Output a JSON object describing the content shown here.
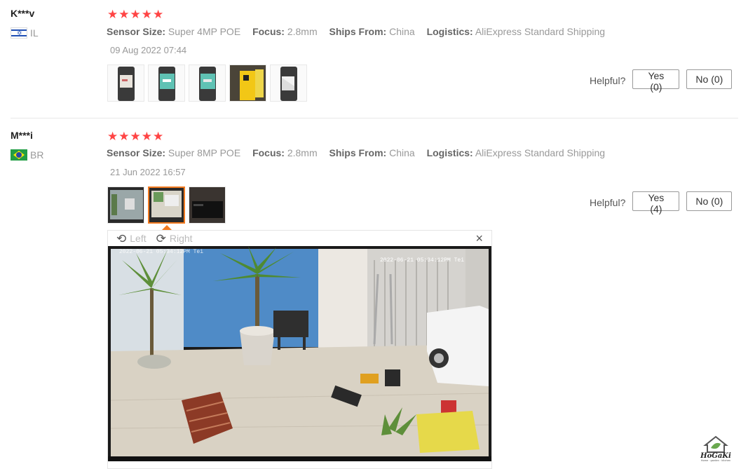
{
  "reviews": [
    {
      "user": "K***v",
      "country": "IL",
      "attrs": [
        {
          "key": "Sensor Size:",
          "value": "Super 4MP POE"
        },
        {
          "key": "Focus:",
          "value": "2.8mm"
        },
        {
          "key": "Ships From:",
          "value": "China"
        },
        {
          "key": "Logistics:",
          "value": "AliExpress Standard Shipping"
        }
      ],
      "date": "09 Aug 2022 07:44",
      "rating": 5,
      "helpful_label": "Helpful?",
      "yes_label": "Yes (0)",
      "no_label": "No (0)"
    },
    {
      "user": "M***i",
      "country": "BR",
      "attrs": [
        {
          "key": "Sensor Size:",
          "value": "Super 8MP POE"
        },
        {
          "key": "Focus:",
          "value": "2.8mm"
        },
        {
          "key": "Ships From:",
          "value": "China"
        },
        {
          "key": "Logistics:",
          "value": "AliExpress Standard Shipping"
        }
      ],
      "date": "21 Jun 2022 16:57",
      "rating": 5,
      "helpful_label": "Helpful?",
      "yes_label": "Yes (4)",
      "no_label": "No (0)"
    }
  ],
  "viewer": {
    "rotate_left": "Left",
    "rotate_right": "Right",
    "close": "×",
    "timestamp": "2022-06-21 05:34:12PM Tei"
  },
  "watermark": {
    "brand": "HoGaKi",
    "tagline": "Home · garden · kitchen"
  },
  "colors": {
    "star": "#ff4444",
    "accent": "#f27a20"
  },
  "icons": {
    "rating": "star-icon",
    "rotate_left": "rotate-left-icon",
    "rotate_right": "rotate-right-icon",
    "close": "close-icon"
  }
}
